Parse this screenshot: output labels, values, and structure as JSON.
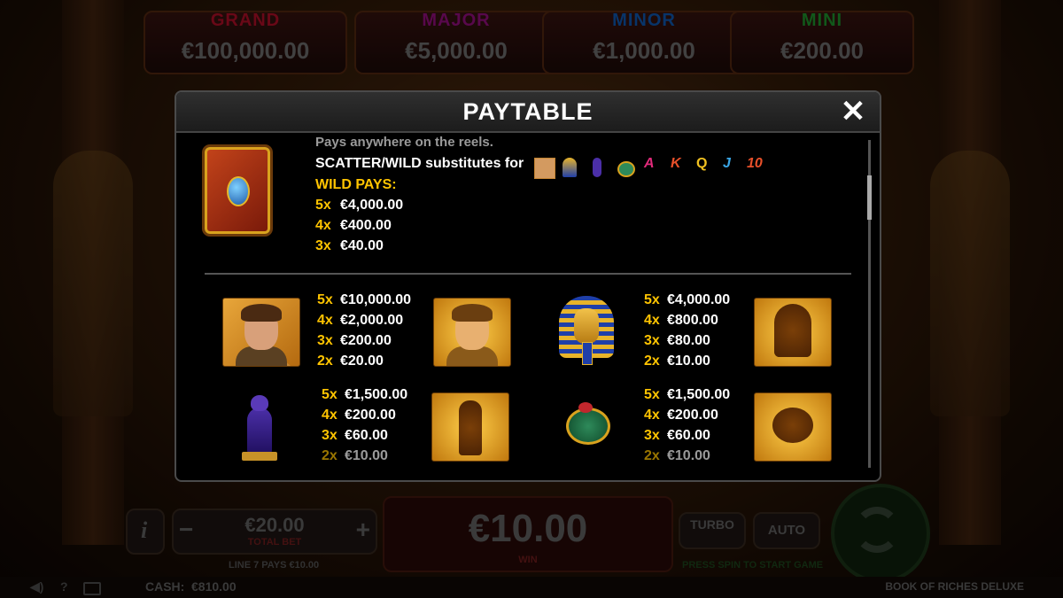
{
  "jackpots": [
    {
      "name": "GRAND",
      "value": "€100,000.00",
      "color": "#c0102a"
    },
    {
      "name": "MAJOR",
      "value": "€5,000.00",
      "color": "#a0108a"
    },
    {
      "name": "MINOR",
      "value": "€1,000.00",
      "color": "#1060c0"
    },
    {
      "name": "MINI",
      "value": "€200.00",
      "color": "#20a030"
    }
  ],
  "controls": {
    "info_label": "i",
    "minus_label": "−",
    "plus_label": "+",
    "total_bet_value": "€20.00",
    "total_bet_label": "TOTAL BET",
    "win_value": "€10.00",
    "win_label": "WIN",
    "turbo_label": "TURBO",
    "auto_label": "AUTO",
    "line_pays": "LINE 7 PAYS €10.00",
    "start_hint": "PRESS SPIN TO START GAME"
  },
  "footer": {
    "help_label": "?",
    "cash_label": "CASH:",
    "cash_value": "€810.00",
    "game_title": "BOOK OF RICHES DELUXE"
  },
  "modal": {
    "title": "PAYTABLE",
    "close_label": "✕",
    "wild": {
      "line1": "Pays anywhere on the reels.",
      "line2": "SCATTER/WILD substitutes for",
      "pays_title": "WILD PAYS:",
      "pays": [
        {
          "mult": "5x",
          "amount": "€4,000.00"
        },
        {
          "mult": "4x",
          "amount": "€400.00"
        },
        {
          "mult": "3x",
          "amount": "€40.00"
        }
      ],
      "substitute_letters": [
        "A",
        "K",
        "Q",
        "J",
        "10"
      ]
    },
    "symbols": [
      {
        "id": "explorer",
        "pays": [
          {
            "mult": "5x",
            "amount": "€10,000.00"
          },
          {
            "mult": "4x",
            "amount": "€2,000.00"
          },
          {
            "mult": "3x",
            "amount": "€200.00"
          },
          {
            "mult": "2x",
            "amount": "€20.00"
          }
        ]
      },
      {
        "id": "pharaoh",
        "pays": [
          {
            "mult": "5x",
            "amount": "€4,000.00"
          },
          {
            "mult": "4x",
            "amount": "€800.00"
          },
          {
            "mult": "3x",
            "amount": "€80.00"
          },
          {
            "mult": "2x",
            "amount": "€10.00"
          }
        ]
      },
      {
        "id": "cat",
        "pays": [
          {
            "mult": "5x",
            "amount": "€1,500.00"
          },
          {
            "mult": "4x",
            "amount": "€200.00"
          },
          {
            "mult": "3x",
            "amount": "€60.00"
          },
          {
            "mult": "2x",
            "amount": "€10.00"
          }
        ]
      },
      {
        "id": "scarab",
        "pays": [
          {
            "mult": "5x",
            "amount": "€1,500.00"
          },
          {
            "mult": "4x",
            "amount": "€200.00"
          },
          {
            "mult": "3x",
            "amount": "€60.00"
          },
          {
            "mult": "2x",
            "amount": "€10.00"
          }
        ]
      }
    ]
  }
}
